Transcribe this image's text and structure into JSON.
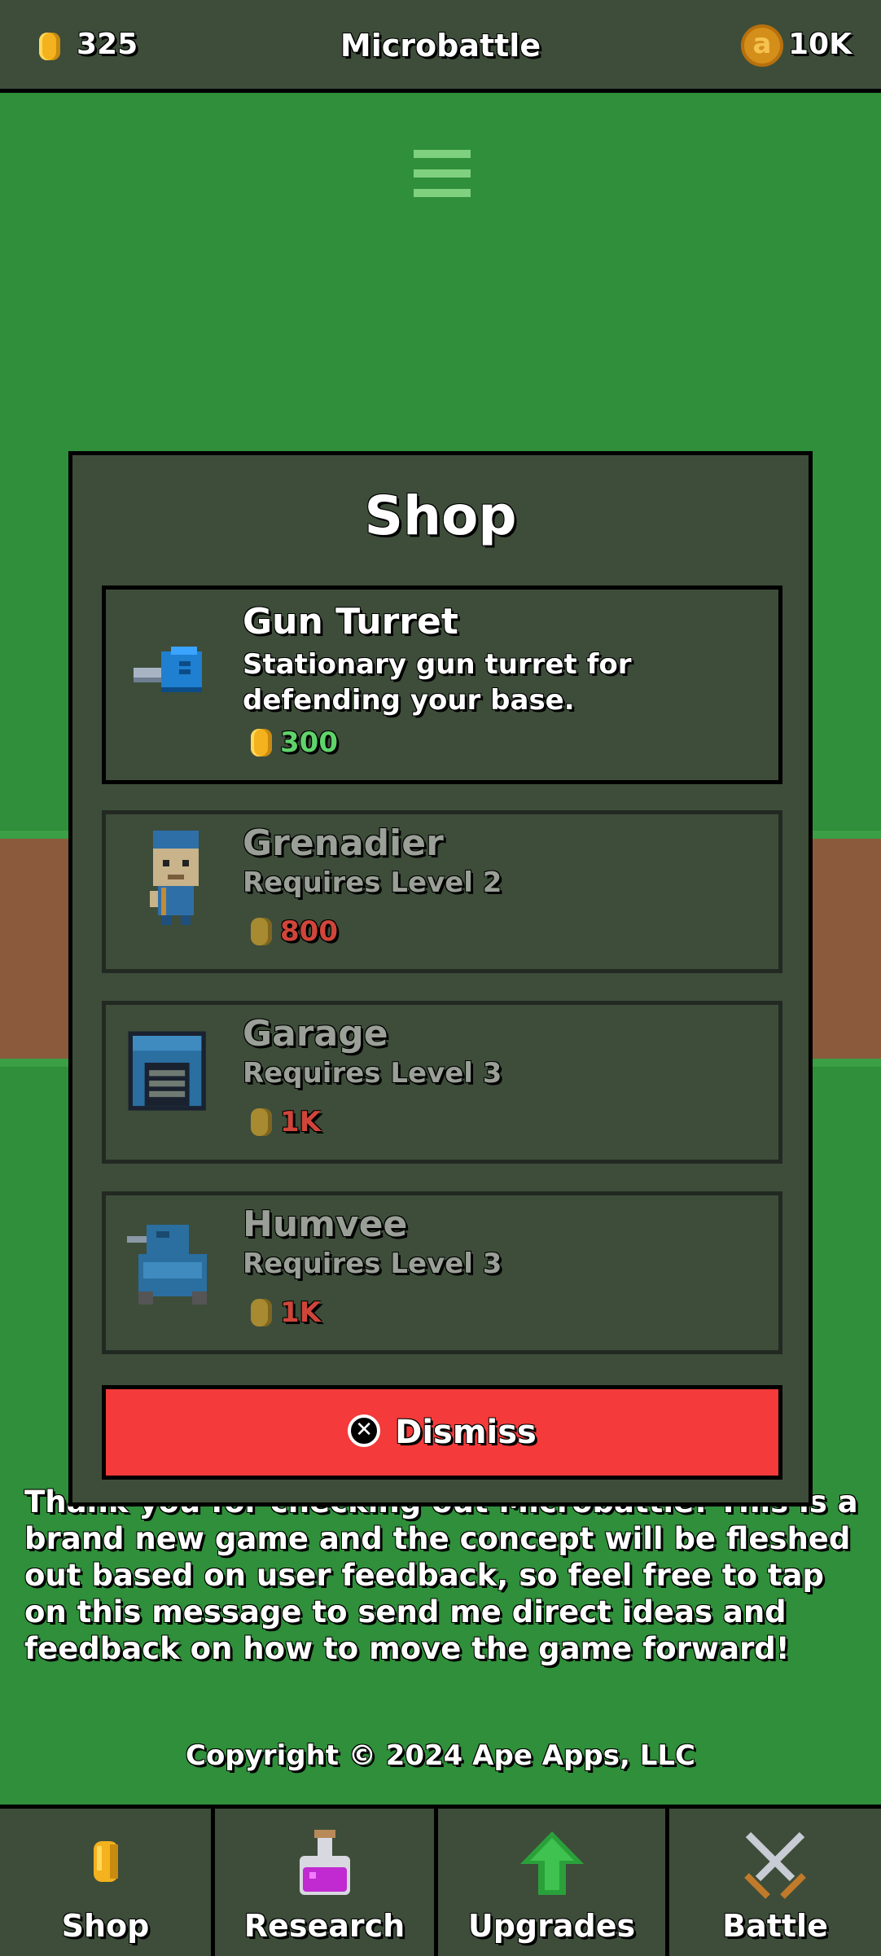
{
  "topbar": {
    "coins": "325",
    "title": "Microbattle",
    "gem_symbol": "a",
    "gems": "10K"
  },
  "shop": {
    "title": "Shop",
    "items": [
      {
        "name": "Gun Turret",
        "description": "Stationary gun turret for defending your base.",
        "price": "300",
        "available": true,
        "icon": "gun-turret-icon"
      },
      {
        "name": "Grenadier",
        "description": "Requires Level 2",
        "price": "800",
        "available": false,
        "icon": "grenadier-icon"
      },
      {
        "name": "Garage",
        "description": "Requires Level 3",
        "price": "1K",
        "available": false,
        "icon": "garage-icon"
      },
      {
        "name": "Humvee",
        "description": "Requires Level 3",
        "price": "1K",
        "available": false,
        "icon": "humvee-icon"
      }
    ],
    "dismiss_label": "Dismiss",
    "dismiss_icon_glyph": "✕"
  },
  "message": "Thank you for checking out Microbattle! This is a brand new game and the concept will be fleshed out based on user feedback, so feel free to tap on this message to send me direct ideas and feedback on how to move the game forward!",
  "copyright": "Copyright © 2024 Ape Apps, LLC",
  "nav": {
    "tabs": [
      {
        "label": "Shop",
        "icon": "coin-icon"
      },
      {
        "label": "Research",
        "icon": "potion-icon"
      },
      {
        "label": "Upgrades",
        "icon": "up-arrow-icon"
      },
      {
        "label": "Battle",
        "icon": "crossed-swords-icon"
      }
    ]
  },
  "colors": {
    "panel": "#3d4d3a",
    "grass": "#2f8f3a",
    "dirt": "#8b5a3c",
    "dismiss": "#f43a3a",
    "price_ok": "#5fd36a",
    "price_locked": "#d0453a",
    "coin": "#f3b21e"
  }
}
